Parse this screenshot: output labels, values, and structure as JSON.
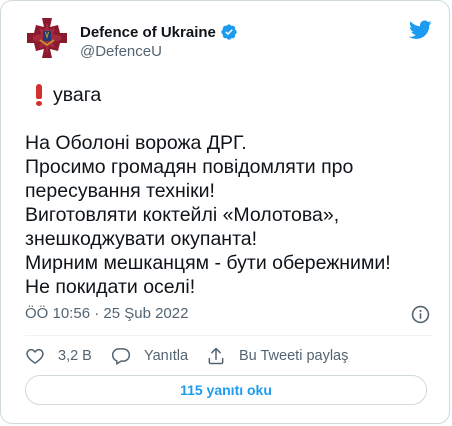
{
  "author": {
    "display_name": "Defence of Ukraine",
    "handle": "@DefenceU",
    "verified": true
  },
  "tweet": {
    "flag_text": "увага",
    "lines": [
      "На Оболоні ворожа ДРГ.",
      "Просимо громадян повідомляти про",
      "пересування техніки!",
      "Виготовляти коктейлі «Молотова»,",
      "знешкоджувати окупанта!",
      "Мирним мешканцям - бути обережними!",
      "Не покидати оселі!"
    ],
    "timestamp": "ÖÖ 10:56 · 25 Şub 2022"
  },
  "actions": {
    "like_count": "3,2 B",
    "reply_label": "Yanıtla",
    "share_label": "Bu Tweeti paylaş"
  },
  "read_replies_label": "115 yanıtı oku",
  "colors": {
    "accent": "#1d9bf0",
    "text": "#0f1419",
    "muted": "#536471",
    "emblem": "#8b1a2e",
    "emblem_gold": "#c9a227",
    "warning": "#d32f2f"
  },
  "icons": {
    "avatar": "defence-emblem",
    "verified": "verified-badge-icon",
    "brand": "twitter-bird-icon",
    "info": "info-icon",
    "like": "heart-icon",
    "reply": "speech-bubble-icon",
    "share": "share-arrow-icon"
  }
}
